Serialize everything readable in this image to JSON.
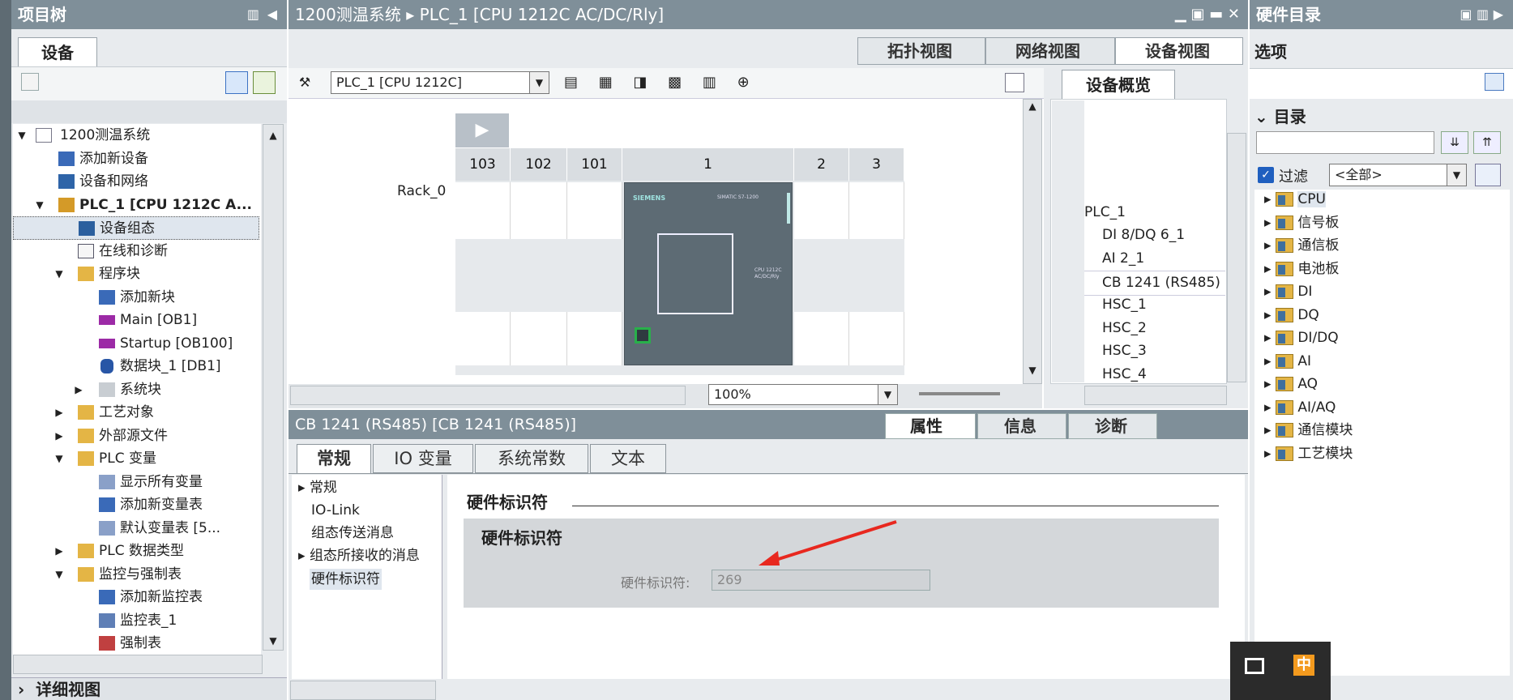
{
  "project_tree": {
    "title": "项目树",
    "tab": "设备",
    "items": [
      {
        "label": "1200测温系统"
      },
      {
        "label": "添加新设备"
      },
      {
        "label": "设备和网络"
      },
      {
        "label": "PLC_1 [CPU 1212C A..."
      },
      {
        "label": "设备组态"
      },
      {
        "label": "在线和诊断"
      },
      {
        "label": "程序块"
      },
      {
        "label": "添加新块"
      },
      {
        "label": "Main [OB1]"
      },
      {
        "label": "Startup [OB100]"
      },
      {
        "label": "数据块_1 [DB1]"
      },
      {
        "label": "系统块"
      },
      {
        "label": "工艺对象"
      },
      {
        "label": "外部源文件"
      },
      {
        "label": "PLC 变量"
      },
      {
        "label": "显示所有变量"
      },
      {
        "label": "添加新变量表"
      },
      {
        "label": "默认变量表 [5..."
      },
      {
        "label": "PLC 数据类型"
      },
      {
        "label": "监控与强制表"
      },
      {
        "label": "添加新监控表"
      },
      {
        "label": "监控表_1"
      },
      {
        "label": "强制表"
      }
    ],
    "detail_view": "详细视图"
  },
  "main": {
    "breadcrumb_root": "1200测温系统",
    "breadcrumb_sep": "▸",
    "breadcrumb_device": "PLC_1 [CPU 1212C AC/DC/Rly]",
    "view_tabs": [
      "拓扑视图",
      "网络视图",
      "设备视图"
    ],
    "device_select": "PLC_1 [CPU 1212C]",
    "rack_label": "Rack_0",
    "slots": [
      "103",
      "102",
      "101",
      "1",
      "2",
      "3"
    ],
    "zoom": "100%",
    "plc_brand": "SIEMENS",
    "plc_model": "SIMATIC S7-1200",
    "plc_cpu": "CPU 1212C AC/DC/Rly"
  },
  "overview": {
    "tab": "设备概览",
    "rows": [
      "PLC_1",
      "DI 8/DQ 6_1",
      "AI 2_1",
      "CB 1241 (RS485)",
      "HSC_1",
      "HSC_2",
      "HSC_3",
      "HSC_4"
    ]
  },
  "properties": {
    "title": "CB 1241 (RS485) [CB 1241 (RS485)]",
    "inspector_tabs": [
      "属性",
      "信息",
      "诊断"
    ],
    "tabs": [
      "常规",
      "IO 变量",
      "系统常数",
      "文本"
    ],
    "nav": [
      "常规",
      "IO-Link",
      "组态传送消息",
      "组态所接收的消息",
      "硬件标识符"
    ],
    "section_title": "硬件标识符",
    "group_title": "硬件标识符",
    "field_label": "硬件标识符:",
    "field_value": "269"
  },
  "catalog": {
    "title": "硬件目录",
    "options": "选项",
    "section": "目录",
    "filter_label": "过滤",
    "filter_value": "<全部>",
    "items": [
      "CPU",
      "信号板",
      "通信板",
      "电池板",
      "DI",
      "DQ",
      "DI/DQ",
      "AI",
      "AQ",
      "AI/AQ",
      "通信模块",
      "工艺模块"
    ]
  },
  "ime": {
    "mode": "中"
  }
}
